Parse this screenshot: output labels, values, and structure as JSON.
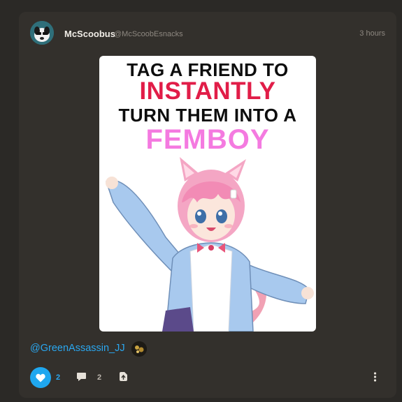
{
  "post": {
    "author_name": "McScoobus",
    "author_handle": "@McScoobEsnacks",
    "timestamp": "3 hours",
    "image_text": {
      "line1": "TAG A FRIEND TO",
      "line2": "INSTANTLY",
      "line3": "TURN THEM INTO A",
      "line4": "FEMBOY"
    },
    "caption_mention": "@GreenAssassin_JJ"
  },
  "actions": {
    "like_count": "2",
    "comment_count": "2"
  },
  "colors": {
    "accent": "#1fa7ef",
    "headline_red": "#e11d48",
    "headline_pink": "#f47ae0"
  },
  "icons": [
    "avatar",
    "heart-icon",
    "comment-icon",
    "share-icon",
    "more-icon"
  ]
}
